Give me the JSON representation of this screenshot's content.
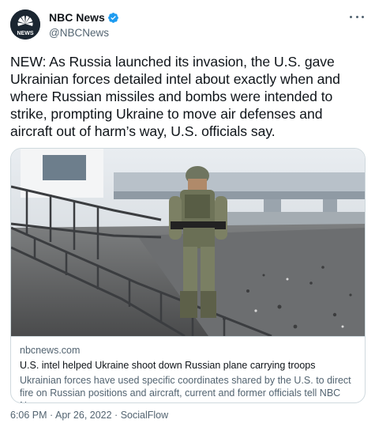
{
  "author": {
    "name": "NBC News",
    "handle": "@NBCNews",
    "avatar_text": "NEWS"
  },
  "tweet": {
    "text": "NEW: As Russia launched its invasion, the U.S. gave Ukrainian forces detailed intel about exactly when and where Russian missiles and bombs were intended to strike, prompting Ukraine to move air defenses and aircraft out of harm’s way, U.S. officials say."
  },
  "card": {
    "domain": "nbcnews.com",
    "title": "U.S. intel helped Ukraine shoot down Russian plane carrying troops",
    "description": "Ukrainian forces have used specific coordinates shared by the U.S. to direct fire on Russian positions and aircraft, current and former officials tell NBC News."
  },
  "meta": {
    "time": "6:06 PM",
    "separator": " · ",
    "date": "Apr 26, 2022",
    "source": "SocialFlow"
  },
  "colors": {
    "verified": "#1d9bf0",
    "text_primary": "#0f1419",
    "text_secondary": "#536471",
    "border": "#cfd9de"
  },
  "icons": [
    "nbc-peacock-logo",
    "verified-badge-icon",
    "more-options-icon"
  ]
}
